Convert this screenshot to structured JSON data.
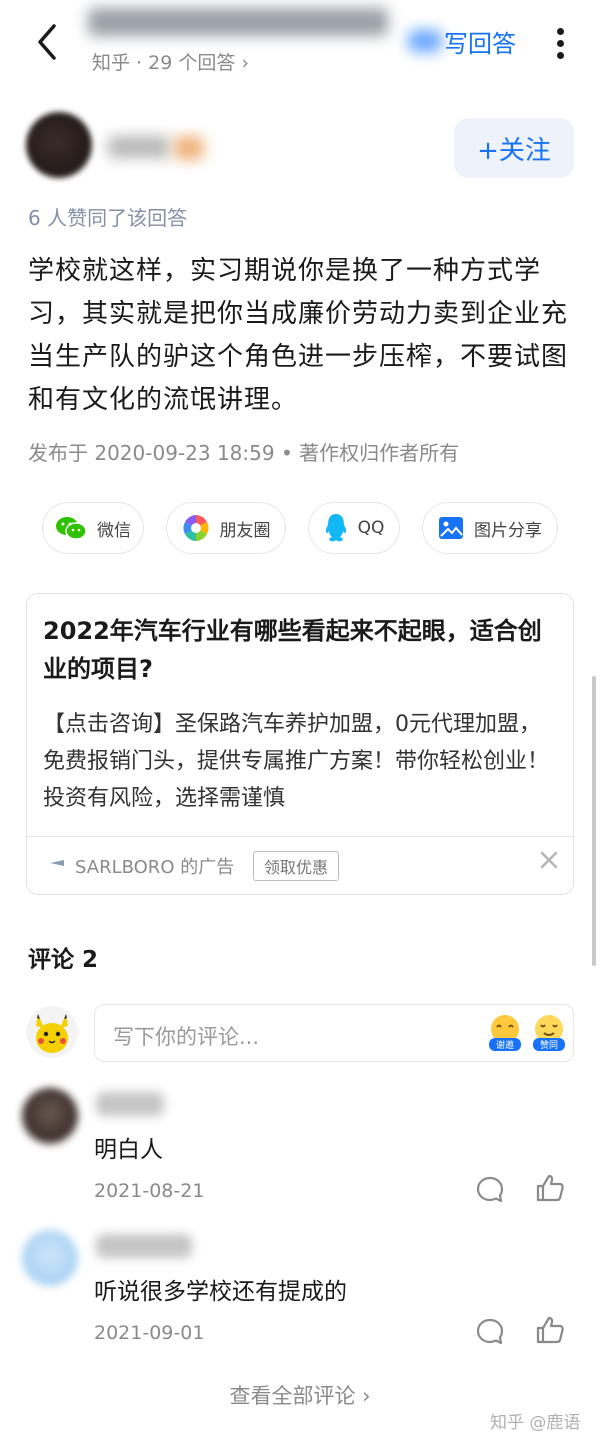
{
  "header": {
    "subtitle": "知乎 · 29 个回答 ›",
    "write_answer_label": "写回答"
  },
  "answer": {
    "follow_label": "+关注",
    "upvote_text": "6 人赞同了该回答",
    "body": "学校就这样，实习期说你是换了一种方式学习，其实就是把你当成廉价劳动力卖到企业充当生产队的驴这个角色进一步压榨，不要试图和有文化的流氓讲理。",
    "meta": "发布于 2020-09-23 18:59 • 著作权归作者所有"
  },
  "share": {
    "wechat": "微信",
    "moments": "朋友圈",
    "qq": "QQ",
    "image": "图片分享"
  },
  "ad": {
    "title": "2022年汽车行业有哪些看起来不起眼，适合创业的项目?",
    "body": "【点击咨询】圣保路汽车养护加盟，0元代理加盟，免费报销门头，提供专属推广方案！带你轻松创业！投资有风险，选择需谨慎",
    "sponsor": "SARLBORO 的广告",
    "coupon_label": "领取优惠"
  },
  "comments": {
    "title": "评论 2",
    "input_placeholder": "写下你的评论...",
    "emoji_1_label": "谢邀",
    "emoji_2_label": "赞同",
    "items": [
      {
        "text": "明白人",
        "date": "2021-08-21"
      },
      {
        "text": "听说很多学校还有提成的",
        "date": "2021-09-01"
      }
    ],
    "view_all": "查看全部评论  ›"
  },
  "watermark": "知乎 @鹿语",
  "colors": {
    "accent": "#1772f6",
    "muted_text": "#8a8a8a",
    "wechat_green": "#2dc100",
    "qq_blue": "#12b7f5"
  }
}
